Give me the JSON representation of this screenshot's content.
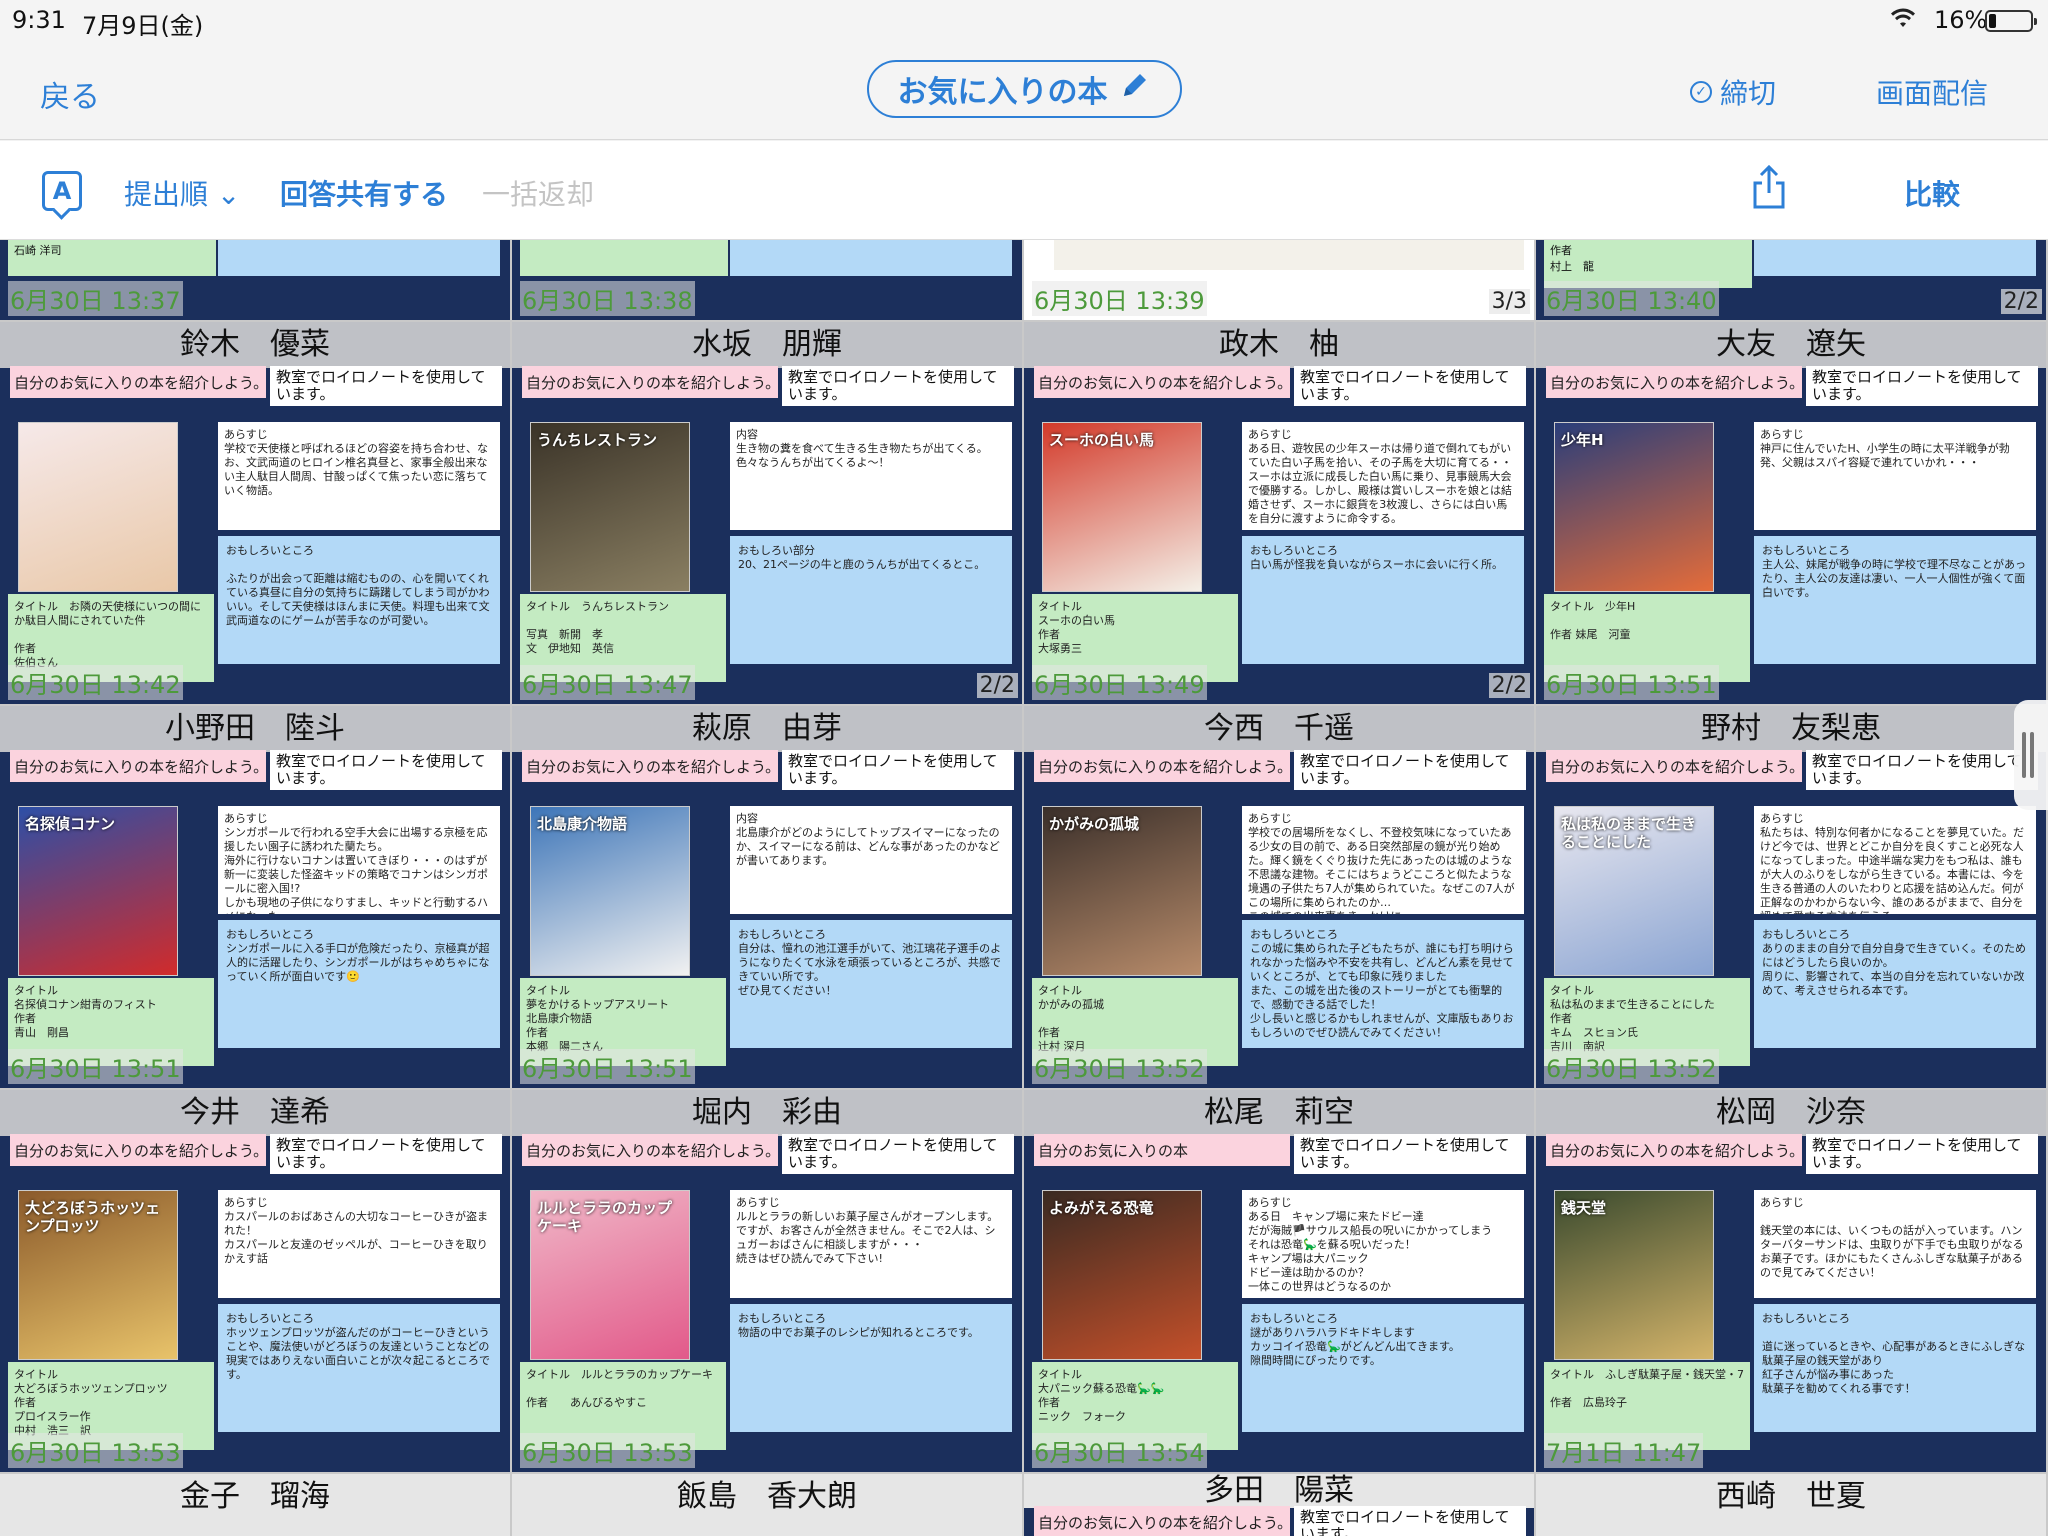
{
  "status": {
    "time": "9:31",
    "date": "7月9日(金)",
    "battery": "16%"
  },
  "nav": {
    "back": "戻る",
    "title": "お気に入りの本",
    "deadline": "締切",
    "broadcast": "画面配信"
  },
  "toolbar": {
    "sort": "提出順 ⌄",
    "share_answers": "回答共有する",
    "bulk_return": "一括返却",
    "compare": "比較"
  },
  "top_row": [
    {
      "title_text": "石崎 洋司",
      "timestamp": "6月30日 13:37"
    },
    {
      "title_text": "",
      "timestamp": "6月30日 13:38"
    },
    {
      "timestamp": "6月30日 13:39",
      "count": "3/3"
    },
    {
      "title_text": "作者\n村上　龍",
      "timestamp": "6月30日 13:40",
      "count": "2/2"
    }
  ],
  "common": {
    "prompt": "自分のお気に入りの本を紹介しよう。",
    "note": "教室でロイロノートを使用しています。"
  },
  "cards": [
    {
      "name": "鈴木　優菜",
      "synopsis": "あらすじ\n学校で天使様と呼ばれるほどの容姿を持ち合わせ、なお、文武両道のヒロイン椎名真昼と、家事全般出来ない主人駄目人間周、甘酸っぱくて焦ったい恋に落ちていく物語。",
      "fun": "おもしろいところ\n\nふたりが出会って距離は縮むものの、心を開いてくれている真昼に自分の気持ちに躊躇してしまう司がかわいい。そして天使様はほんまに天使。料理も出来て文武両道なのにゲームが苦手なのが可愛い。",
      "titlebox": "タイトル　お隣の天使様にいつの間にか駄目人間にされていた件\n\n作者\n佐伯さん",
      "timestamp": "6月30日 13:42",
      "count": ""
    },
    {
      "name": "水坂　朋輝",
      "synopsis": "内容\n生き物の糞を食べて生きる生き物たちが出てくる。色々なうんちが出てくるよ〜！",
      "fun": "おもしろい部分\n20、21ページの牛と鹿のうんちが出てくるとこ。",
      "titlebox": "タイトル　うんちレストラン\n\n写真　新開　孝\n文　伊地知　英信",
      "timestamp": "6月30日 13:47",
      "count": "2/2"
    },
    {
      "name": "政木　柚",
      "synopsis": "あらすじ\nある日、遊牧民の少年スーホは帰り道で倒れてもがいていた白い子馬を拾い、その子馬を大切に育てる・・スーホは立派に成長した白い馬に乗り、見事競馬大会で優勝する。しかし、殿様は賞いしスーホを娘とは結婚させず、スーホに銀貨を3枚渡し、さらには白い馬を自分に渡すように命令する。",
      "fun": "おもしろいところ\n白い馬が怪我を負いながらスーホに会いに行く所。",
      "titlebox": "タイトル\nスーホの白い馬\n作者\n大塚勇三",
      "timestamp": "6月30日 13:49",
      "count": "2/2"
    },
    {
      "name": "大友　遼矢",
      "synopsis": "あらすじ\n神戸に住んでいたH、小学生の時に太平洋戦争が勃発、父親はスパイ容疑で連れていかれ・・・",
      "fun": "おもしろいところ\n主人公、妹尾が戦争の時に学校で理不尽なことがあったり、主人公の友達は凄い、一人一人個性が強くて面白いです。",
      "titlebox": "タイトル　少年H\n\n作者 妹尾　河童",
      "timestamp": "6月30日 13:51",
      "count": ""
    },
    {
      "name": "小野田　陸斗",
      "synopsis": "あらすじ\nシンガポールで行われる空手大会に出場する京極を応援したい園子に誘われた蘭たち。\n海外に行けないコナンは置いてきぼり・・・のはずが新一に変装した怪盗キッドの策略でコナンはシンガポールに密入国!?\nしかも現地の子供になりすまし、キッドと行動するハメになった。",
      "fun": "おもしろいところ\nシンガポールに入る手口が危険だったり、京極真が超人的に活躍したり、シンガポールがはちゃめちゃになっていく所が面白いです🙂",
      "titlebox": "タイトル\n名探偵コナン紺青のフィスト\n作者\n青山　剛昌",
      "timestamp": "6月30日 13:51",
      "count": ""
    },
    {
      "name": "萩原　由芽",
      "synopsis": "内容\n北島康介がどのようにしてトップスイマーになったのか、スイマーになる前は、どんな事があったのかなどが書いてあります。",
      "fun": "おもしろいところ\n自分は、憧れの池江選手がいて、池江璃花子選手のようになりたくて水泳を頑張っているところが、共感できていい所です。\nぜひ見てください！",
      "titlebox": "タイトル\n夢をかけるトップアスリート\n北島康介物語\n作者\n本郷　陽二さん",
      "timestamp": "6月30日 13:51",
      "count": ""
    },
    {
      "name": "今西　千遥",
      "synopsis": "あらすじ\n学校での居場所をなくし、不登校気味になっていたある少女の目の前で、ある日突然部屋の鏡が光り始めた。輝く鏡をくぐり抜けた先にあったのは城のような不思議な建物。そこにはちょうどこころと似たような境遇の子供たち7人が集められていた。なぜこの7人がこの場所に集められたのか…\nこの城での出来事をきっかけに\n7人の心情が変わっていく物語です",
      "fun": "おもしろいところ\nこの城に集められた子どもたちが、誰にも打ち明けられなかった悩みや不安を共有し、どんどん素を見せていくところが、とても印象に残りました\nまた、この城を出た後のストーリーがとても衝撃的で、感動できる話でした！\n少し長いと感じるかもしれませんが、文庫版もありおもしろいのでぜひ読んでみてください！",
      "titlebox": "タイトル\nかがみの孤城\n\n作者\n辻村 深月",
      "timestamp": "6月30日 13:52",
      "count": ""
    },
    {
      "name": "野村　友梨恵",
      "synopsis": "あらすじ\n私たちは、特別な何者かになることを夢見ていた。だけど今では、世界とどこか自分を良くすこと必死な人になってしまった。中途半端な実力をもつ私は、誰もが大人のふりをしながら生きている。本書には、今を生きる普通の人のいたわりと応援を詰め込んだ。何が正解なのかわからない今、誰のあるがままで、自分を認めて愛する方法を伝える。",
      "fun": "おもしろいところ\nありのままの自分で自分自身で生きていく。そのためにはどうしたら良いのか。\n周りに、影響されて、本当の自分を忘れていないか改めて、考えさせられる本です。",
      "titlebox": "タイトル\n私は私のままで生きることにした\n作者\nキム　スヒョン氏\n吉川　南訳",
      "timestamp": "6月30日 13:52",
      "count": ""
    },
    {
      "name": "今井　達希",
      "synopsis": "あらすじ\nカスパールのおばあさんの大切なコーヒーひきが盗まれた！\nカスパールと友達のゼッペルが、コーヒーひきを取りかえす話",
      "fun": "おもしろいところ\nホッツェンプロッツが盗んだのがコーヒーひきということや、魔法使いがどろぼうの友達ということなどの現実ではありえない面白いことが次々起こるところです。",
      "titlebox": "タイトル\n大どろぼうホッツェンプロッツ\n作者\nプロイスラー作\n中村　浩三　訳",
      "timestamp": "6月30日 13:53",
      "count": ""
    },
    {
      "name": "堀内　彩由",
      "synopsis": "あらすじ\nルルとララの新しいお菓子屋さんがオープンします。ですが、お客さんが全然きません。そこで2人は、シュガーおばさんに相談しますが・・・\n続きはぜひ読んでみて下さい!",
      "fun": "おもしろいところ\n物語の中でお菓子のレシピが知れるところです。",
      "titlebox": "タイトル　ルルとララのカップケーキ\n\n作者　　あんびるやすこ",
      "timestamp": "6月30日 13:53",
      "count": ""
    },
    {
      "name": "松尾　莉空",
      "prompt": "自分のお気に入りの本",
      "synopsis": "あらすじ\nある日　キャンプ場に来たドビー達\nだが海賊🏴サウルス船長の呪いにかかってしまう\nそれは恐竜🦕を蘇る呪いだった！\nキャンプ場は大パニック\nドビー達は助かるのか？\n一体この世界はどうなるのか",
      "fun": "おもしろいところ\n謎がありハラハラドキドキします\nカッコイイ恐竜🦕がどんどん出てきます。\n隙間時間にぴったりです。",
      "titlebox": "タイトル\n大パニック蘇る恐竜🦕🦕\n作者\nニック　フォーク",
      "timestamp": "6月30日 13:54",
      "count": ""
    },
    {
      "name": "松岡　沙奈",
      "synopsis": "あらすじ\n\n銭天堂の本には、いくつもの話が入っています。ハンターバターサンドは、虫取りが下手でも虫取りがなるお菓子です。ほかにもたくさんふしぎな駄菓子があるので見てみてください！",
      "fun": "おもしろいところ\n\n道に迷っているときや、心配事があるときにふしぎな駄菓子屋の銭天堂があり\n紅子さんが悩み事にあった\n駄菓子を勧めてくれる事です！",
      "titlebox": "タイトル　ふしぎ駄菓子屋・銭天堂・7\n\n作者　広島玲子",
      "timestamp": "7月1日 11:47",
      "count": ""
    }
  ],
  "bottom_row": [
    {
      "name": "金子　瑠海"
    },
    {
      "name": "飯島　香大朗"
    },
    {
      "name": "多田　陽菜"
    },
    {
      "name": "西崎　世夏"
    }
  ],
  "cover_texts": [
    "",
    "うんちレストラン",
    "スーホの白い馬",
    "少年H",
    "名探偵コナン",
    "北島康介物語",
    "かがみの孤城",
    "私は私のままで生きることにした",
    "大どろぼうホッツェンプロッツ",
    "ルルとララのカップケーキ",
    "よみがえる恐竜",
    "銭天堂"
  ]
}
